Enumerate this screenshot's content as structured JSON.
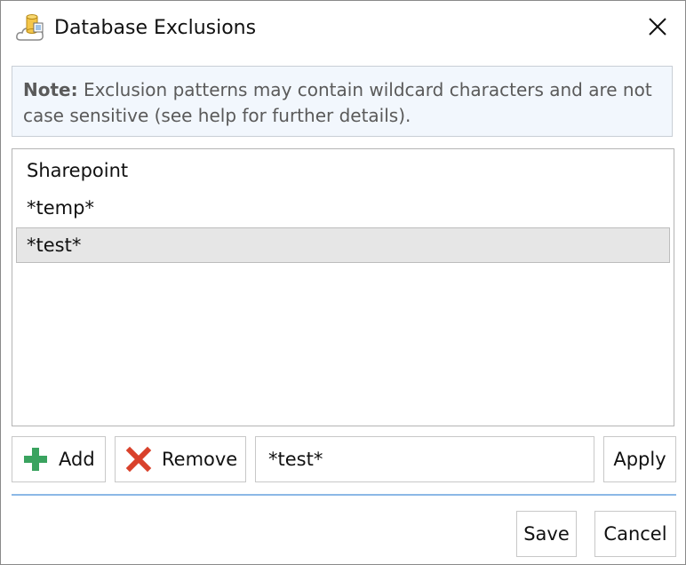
{
  "window": {
    "title": "Database Exclusions",
    "icon": "database-cloud-icon",
    "close_icon": "close-icon"
  },
  "note": {
    "label": "Note:",
    "text": " Exclusion patterns may contain wildcard characters and are not case sensitive (see help for further details)."
  },
  "exclusions": {
    "items": [
      {
        "label": "Sharepoint",
        "selected": false
      },
      {
        "label": "*temp*",
        "selected": false
      },
      {
        "label": "*test*",
        "selected": true
      }
    ]
  },
  "toolbar": {
    "add_label": "Add",
    "add_icon": "plus-icon",
    "remove_label": "Remove",
    "remove_icon": "x-icon",
    "pattern_value": "*test*",
    "apply_label": "Apply"
  },
  "footer": {
    "save_label": "Save",
    "cancel_label": "Cancel"
  },
  "colors": {
    "note_bg": "#f2f7fd",
    "selected_bg": "#e6e6e6",
    "add_icon": "#3aa35f",
    "remove_icon": "#d9412b",
    "divider": "#8cb8e6"
  }
}
